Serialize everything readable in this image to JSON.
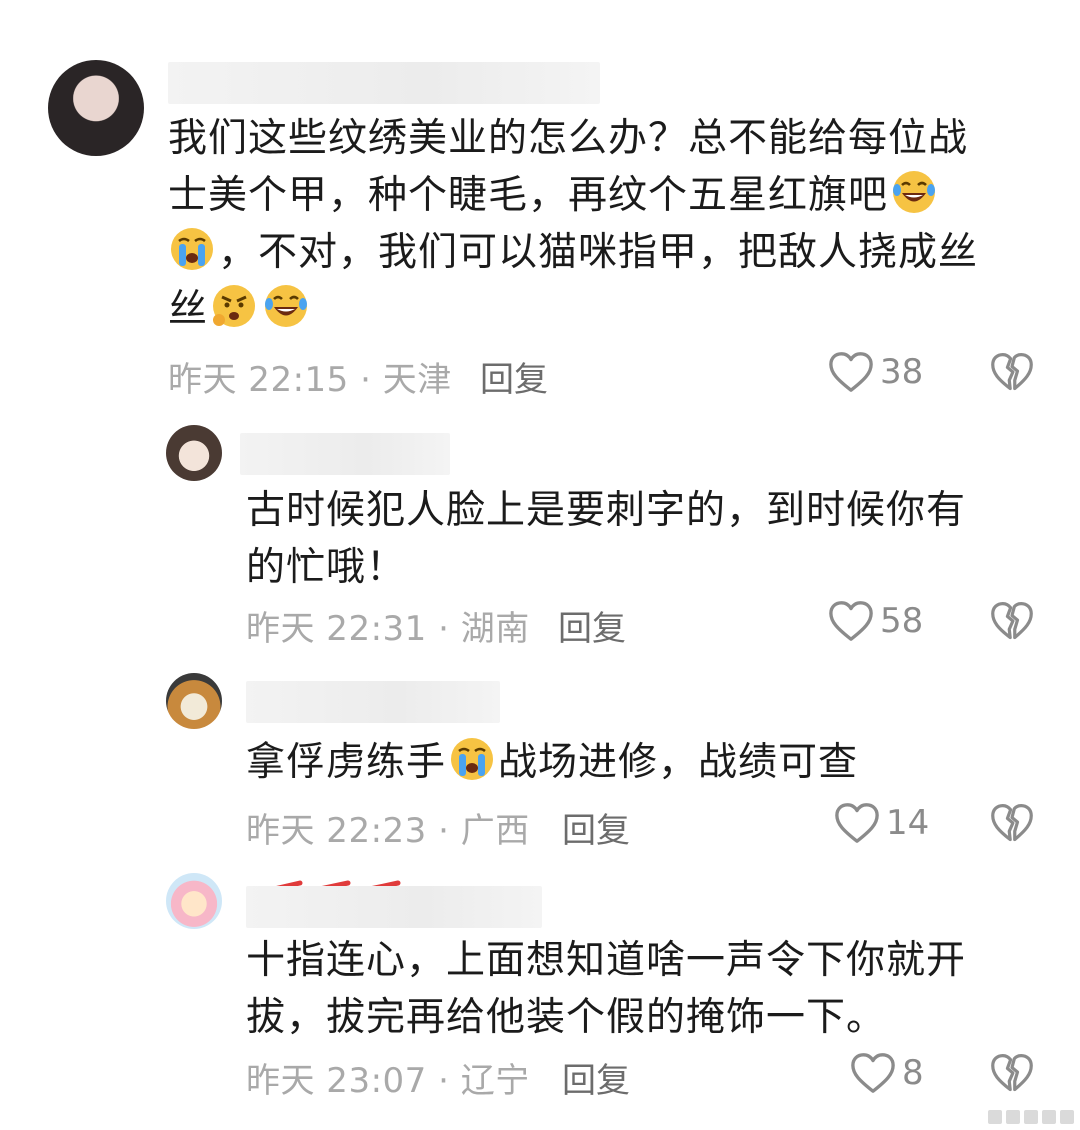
{
  "comments": [
    {
      "text_lines": [
        "我们这些纹绣美业的怎么办？总不能给每位战",
        "士美个甲，种个睫毛，再纹个五星红旗吧",
        "，不对，我们可以猫咪指甲，把敌人挠成丝",
        "丝"
      ],
      "meta": "昨天 22:15 · 天津",
      "reply": "回复",
      "likes": "38"
    },
    {
      "text_lines": [
        "古时候犯人脸上是要刺字的，到时候你有",
        "的忙哦！"
      ],
      "meta": "昨天 22:31 · 湖南",
      "reply": "回复",
      "likes": "58"
    },
    {
      "text_lines": [
        "拿俘虏练手",
        "战场进修，战绩可查"
      ],
      "meta": "昨天 22:23 · 广西",
      "reply": "回复",
      "likes": "14"
    },
    {
      "text_lines": [
        "十指连心，上面想知道啥一声令下你就开",
        "拔，拔完再给他装个假的掩饰一下。"
      ],
      "meta": "昨天 23:07 · 辽宁",
      "reply": "回复",
      "likes": "8"
    }
  ],
  "icons": {
    "like": "heart-outline-icon",
    "dislike": "broken-heart-icon"
  },
  "colors": {
    "text": "#1b1b1b",
    "meta": "#a9a9a9",
    "reply": "#6c6c6c",
    "background": "#ffffff"
  }
}
